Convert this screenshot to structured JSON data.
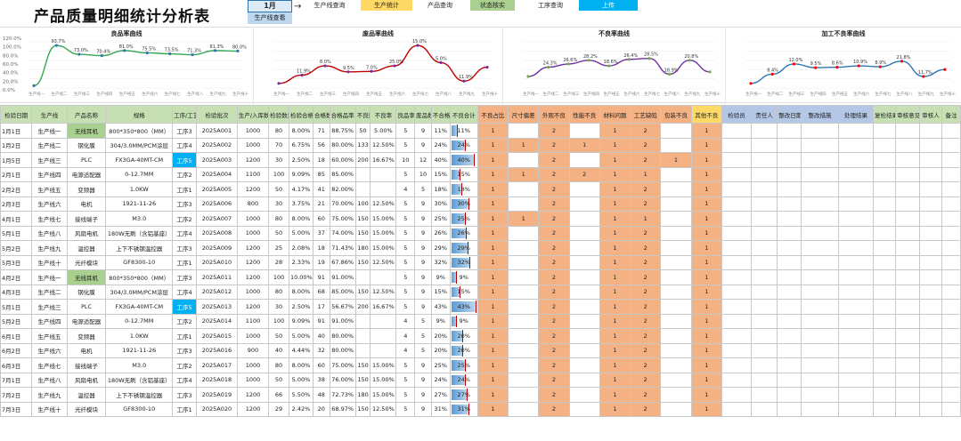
{
  "header": {
    "title": "产品质量明细统计分析表",
    "month": "1月",
    "month_sub": "生产线查看",
    "buttons": [
      "生产线查询",
      "生产统计",
      "产品查询",
      "状态核实",
      "工序查询",
      "上传"
    ]
  },
  "charts": [
    {
      "title": "良品率曲线",
      "color": "#33a852",
      "labels": [
        "93.7%",
        "73.0%",
        "70.4%",
        "81.0%",
        "75.5%",
        "73.5%",
        "71.3%",
        "81.3%",
        "80.0%"
      ],
      "values": [
        0.05,
        0.92,
        0.73,
        0.7,
        0.81,
        0.76,
        0.74,
        0.72,
        0.81,
        0.8
      ],
      "yticks": [
        "120.0%",
        "100.0%",
        "80.0%",
        "60.0%",
        "40.0%",
        "20.0%",
        "0.0%"
      ]
    },
    {
      "title": "废品率曲线",
      "color": "#c00000",
      "labels": [
        "11.9%",
        "8.0%",
        "9.5%",
        "7.0%",
        "25.0%",
        "15.0%",
        "5.0%",
        "11.9%"
      ],
      "values": [
        0.1,
        0.28,
        0.48,
        0.35,
        0.36,
        0.48,
        0.92,
        0.55,
        0.15,
        0.45
      ],
      "yticks": []
    },
    {
      "title": "不良率曲线",
      "color": "#7030a0",
      "labels": [
        "24.3%",
        "26.6%",
        "28.2%",
        "18.6%",
        "26.4%",
        "28.5%",
        "18.9%",
        "20.8%"
      ],
      "values": [
        0.25,
        0.45,
        0.52,
        0.6,
        0.48,
        0.62,
        0.64,
        0.3,
        0.6,
        0.35
      ],
      "yticks": []
    },
    {
      "title": "加工不良率曲线",
      "color": "#2e75b6",
      "labels": [
        "8.4%",
        "12.0%",
        "9.5%",
        "8.6%",
        "10.9%",
        "8.9%",
        "21.8%",
        "11.7%"
      ],
      "values": [
        0.1,
        0.3,
        0.52,
        0.44,
        0.45,
        0.48,
        0.46,
        0.58,
        0.25,
        0.4
      ],
      "yticks": []
    }
  ],
  "table": {
    "headers": [
      "检验日期",
      "生产线",
      "产品名称",
      "规格",
      "工序/工艺",
      "检验批次",
      "生产/入库数量",
      "检验数量",
      "检验合格率",
      "合格数",
      "合格品率",
      "不良数",
      "不良率",
      "良品率",
      "废品数",
      "不合格数",
      "不良合计",
      "不良占比",
      "尺寸偏差",
      "外观不良",
      "性能不良",
      "材料问题",
      "工艺缺陷",
      "包装不良",
      "其他不良",
      "检验员",
      "责任人",
      "整改日期",
      "整改措施",
      "处理结果",
      "复检结果",
      "审核意见",
      "审核人",
      "备注"
    ],
    "defect_group": "不良原因分析",
    "rate_group": "不良率统计",
    "track_group": "生产质量追踪统计",
    "rows": [
      [
        "1月1日",
        "生产线一",
        "无线耳机",
        "800*350*800（MM）",
        "工序3",
        "2025A001",
        "1000",
        "80",
        "8.00%",
        "71",
        "88.75%",
        "50",
        "5.00%",
        "5",
        "9",
        "11%"
      ],
      [
        "1月2日",
        "生产线二",
        "钢化膜",
        "304/3.0MM/PCM涂层",
        "工序4",
        "2025A002",
        "1000",
        "70",
        "6.75%",
        "56",
        "80.00%",
        "133",
        "12.50%",
        "5",
        "9",
        "24%"
      ],
      [
        "1月5日",
        "生产线三",
        "PLC",
        "FX3GA-40MT-CM",
        "工序5",
        "2025A003",
        "1200",
        "30",
        "2.50%",
        "18",
        "60.00%",
        "200",
        "16.67%",
        "10",
        "12",
        "40%"
      ],
      [
        "2月1日",
        "生产线四",
        "电源适配器",
        "0-12.7MM",
        "工序2",
        "2025A004",
        "1100",
        "100",
        "9.09%",
        "85",
        "85.00%",
        "",
        "",
        "5",
        "10",
        "15%"
      ],
      [
        "2月2日",
        "生产线五",
        "变频器",
        "1.0KW",
        "工序1",
        "2025A005",
        "1200",
        "50",
        "4.17%",
        "41",
        "82.00%",
        "",
        "",
        "4",
        "5",
        "18%"
      ],
      [
        "2月3日",
        "生产线六",
        "电机",
        "1921-11-26",
        "工序3",
        "2025A006",
        "800",
        "30",
        "3.75%",
        "21",
        "70.00%",
        "100",
        "12.50%",
        "5",
        "9",
        "30%"
      ],
      [
        "4月1日",
        "生产线七",
        "接线端子",
        "M3.0",
        "工序2",
        "2025A007",
        "1000",
        "80",
        "8.00%",
        "60",
        "75.00%",
        "150",
        "15.00%",
        "5",
        "9",
        "25%"
      ],
      [
        "5月1日",
        "生产线八",
        "风扇电机",
        "180W无刷（含铝基座）",
        "工序4",
        "2025A008",
        "1000",
        "50",
        "5.00%",
        "37",
        "74.00%",
        "150",
        "15.00%",
        "5",
        "9",
        "26%"
      ],
      [
        "5月2日",
        "生产线九",
        "温控器",
        "上下不锈钢温控器",
        "工序3",
        "2025A009",
        "1200",
        "25",
        "2.08%",
        "18",
        "71.43%",
        "180",
        "15.00%",
        "5",
        "9",
        "29%"
      ],
      [
        "5月3日",
        "生产线十",
        "光纤模块",
        "GF8300-10",
        "工序1",
        "2025A010",
        "1200",
        "28",
        "2.33%",
        "19",
        "67.86%",
        "150",
        "12.50%",
        "5",
        "9",
        "32%"
      ],
      [
        "4月2日",
        "生产线一",
        "无线耳机",
        "800*350*800（MM）",
        "工序3",
        "2025A011",
        "1200",
        "100",
        "10.00%",
        "91",
        "91.00%",
        "",
        "",
        "5",
        "9",
        "9%"
      ],
      [
        "4月3日",
        "生产线二",
        "钢化膜",
        "304/3.0MM/PCM涂层",
        "工序4",
        "2025A012",
        "1000",
        "80",
        "8.00%",
        "68",
        "85.00%",
        "150",
        "12.50%",
        "5",
        "9",
        "15%"
      ],
      [
        "5月1日",
        "生产线三",
        "PLC",
        "FX3GA-40MT-CM",
        "工序5",
        "2025A013",
        "1200",
        "30",
        "2.50%",
        "17",
        "56.67%",
        "200",
        "16.67%",
        "5",
        "9",
        "43%"
      ],
      [
        "5月2日",
        "生产线四",
        "电源适配器",
        "0-12.7MM",
        "工序2",
        "2025A014",
        "1100",
        "100",
        "9.09%",
        "91",
        "91.00%",
        "",
        "",
        "4",
        "5",
        "9%"
      ],
      [
        "6月1日",
        "生产线五",
        "变频器",
        "1.0KW",
        "工序1",
        "2025A015",
        "1000",
        "50",
        "5.00%",
        "40",
        "80.00%",
        "",
        "",
        "4",
        "5",
        "20%"
      ],
      [
        "6月2日",
        "生产线六",
        "电机",
        "1921-11-26",
        "工序3",
        "2025A016",
        "900",
        "40",
        "4.44%",
        "32",
        "80.00%",
        "",
        "",
        "4",
        "5",
        "20%"
      ],
      [
        "6月3日",
        "生产线七",
        "接线端子",
        "M3.0",
        "工序2",
        "2025A017",
        "1000",
        "80",
        "8.00%",
        "60",
        "75.00%",
        "150",
        "15.00%",
        "5",
        "9",
        "25%"
      ],
      [
        "7月1日",
        "生产线八",
        "风扇电机",
        "180W无刷（含铝基座）",
        "工序4",
        "2025A018",
        "1000",
        "50",
        "5.00%",
        "38",
        "76.00%",
        "150",
        "15.00%",
        "5",
        "9",
        "24%"
      ],
      [
        "7月2日",
        "生产线九",
        "温控器",
        "上下不锈钢温控器",
        "工序3",
        "2025A019",
        "1200",
        "66",
        "5.50%",
        "48",
        "72.73%",
        "180",
        "15.00%",
        "5",
        "9",
        "27%"
      ],
      [
        "7月3日",
        "生产线十",
        "光纤模块",
        "GF8300-10",
        "工序1",
        "2025A020",
        "1200",
        "29",
        "2.42%",
        "20",
        "68.97%",
        "150",
        "12.50%",
        "5",
        "9",
        "31%"
      ]
    ],
    "defect_pattern": [
      [
        1,
        0,
        2,
        0,
        1,
        2,
        0,
        1
      ],
      [
        1,
        1,
        2,
        1,
        1,
        2,
        0,
        1
      ],
      [
        1,
        0,
        2,
        0,
        1,
        2,
        1,
        1
      ],
      [
        1,
        1,
        2,
        2,
        1,
        1,
        0,
        1
      ],
      [
        1,
        0,
        2,
        0,
        1,
        2,
        0,
        1
      ],
      [
        1,
        0,
        2,
        0,
        1,
        2,
        0,
        1
      ],
      [
        1,
        1,
        2,
        0,
        1,
        1,
        0,
        1
      ],
      [
        1,
        0,
        2,
        0,
        1,
        2,
        0,
        1
      ],
      [
        1,
        0,
        2,
        0,
        1,
        2,
        0,
        1
      ],
      [
        1,
        0,
        2,
        0,
        1,
        2,
        0,
        1
      ],
      [
        1,
        0,
        2,
        0,
        1,
        2,
        0,
        1
      ],
      [
        1,
        0,
        2,
        0,
        1,
        2,
        0,
        1
      ],
      [
        1,
        0,
        2,
        0,
        1,
        2,
        0,
        1
      ],
      [
        1,
        0,
        2,
        0,
        1,
        2,
        0,
        1
      ],
      [
        1,
        0,
        2,
        0,
        1,
        2,
        0,
        1
      ],
      [
        1,
        0,
        2,
        0,
        1,
        2,
        0,
        1
      ],
      [
        1,
        0,
        2,
        0,
        1,
        2,
        0,
        1
      ],
      [
        1,
        0,
        2,
        0,
        1,
        2,
        0,
        1
      ],
      [
        1,
        0,
        2,
        0,
        1,
        2,
        0,
        1
      ],
      [
        1,
        0,
        2,
        0,
        1,
        2,
        0,
        1
      ]
    ]
  }
}
